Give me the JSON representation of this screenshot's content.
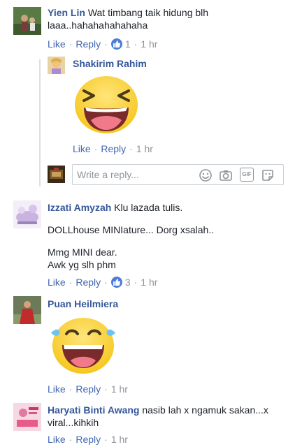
{
  "actions": {
    "like": "Like",
    "reply": "Reply",
    "sep": "·"
  },
  "comments": [
    {
      "author": "Yien Lin",
      "text": "Wat timbang taik hidung blh laaa..hahahahahahaha",
      "like_count": "1",
      "time": "1 hr",
      "reply": {
        "author": "Shakirim Rahim",
        "sticker": "laughing-emoji-sticker",
        "time": "1 hr"
      }
    },
    {
      "author": "Izzati Amyzah",
      "text_lines": [
        "Klu lazada tulis.",
        "DOLLhouse MINIature... Dorg xsalah..",
        "Mmg MINI dear.",
        "Awk yg slh phm"
      ],
      "like_count": "3",
      "time": "1 hr"
    },
    {
      "author": "Puan Heilmiera",
      "sticker": "tears-of-joy-emoji-sticker",
      "time": "1 hr"
    },
    {
      "author": "Haryati Binti Awang",
      "text": "nasib lah x ngamuk sakan...x viral...kihkih",
      "time": "1 hr"
    }
  ],
  "reply_input": {
    "placeholder": "Write a reply..."
  },
  "reply_box_icons": [
    "emoji-icon",
    "camera-icon",
    "gif-icon",
    "sticker-icon"
  ],
  "colors": {
    "name": "#365899",
    "link": "#4267b2",
    "meta": "#90949c",
    "like_badge": "#4c7bd9"
  }
}
